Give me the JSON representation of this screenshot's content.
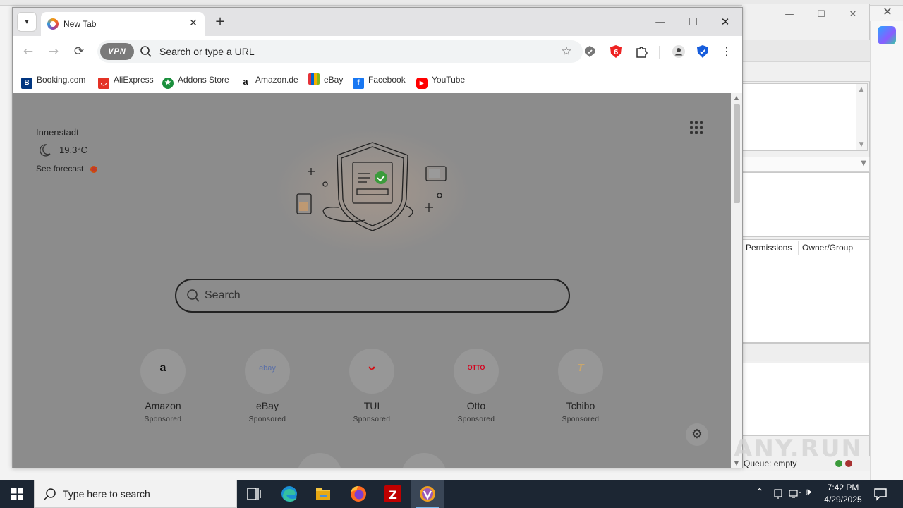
{
  "background_app": {
    "columns": [
      "Permissions",
      "Owner/Group"
    ],
    "queue_status": "Queue: empty"
  },
  "browser": {
    "tab_title": "New Tab",
    "omnibox_placeholder": "Search or type a URL",
    "vpn_label": "VPN",
    "bookmarks": [
      {
        "label": "Booking.com",
        "icon": "booking-icon",
        "color": "#003580"
      },
      {
        "label": "AliExpress",
        "icon": "aliexpress-icon",
        "color": "#e43225"
      },
      {
        "label": "Addons Store",
        "icon": "addons-store-icon",
        "color": "#1a8f3c"
      },
      {
        "label": "Amazon.de",
        "icon": "amazon-icon",
        "color": "#111111"
      },
      {
        "label": "eBay",
        "icon": "ebay-icon",
        "color": "#e53238"
      },
      {
        "label": "Facebook",
        "icon": "facebook-icon",
        "color": "#1877f2"
      },
      {
        "label": "YouTube",
        "icon": "youtube-icon",
        "color": "#ff0000"
      }
    ]
  },
  "newtab": {
    "weather": {
      "location": "Innenstadt",
      "temperature": "19.3°C",
      "forecast_link": "See forecast"
    },
    "search_placeholder": "Search",
    "tiles": [
      {
        "name": "Amazon",
        "logo": "a",
        "sponsored": "Sponsored",
        "logo_color": "#111111"
      },
      {
        "name": "eBay",
        "logo": "ebay",
        "sponsored": "Sponsored",
        "logo_color": "#5a6fa8"
      },
      {
        "name": "TUI",
        "logo": "ᴗ",
        "sponsored": "Sponsored",
        "logo_color": "#d40e14"
      },
      {
        "name": "Otto",
        "logo": "OTTO",
        "sponsored": "Sponsored",
        "logo_color": "#d4021d"
      },
      {
        "name": "Tchibo",
        "logo": "T",
        "sponsored": "Sponsored",
        "logo_color": "#c9a66b"
      }
    ]
  },
  "watermark": "ANY.RUN",
  "taskbar": {
    "search_placeholder": "Type here to search",
    "time": "7:42 PM",
    "date": "4/29/2025"
  },
  "colors": {
    "taskbar": "#1c2633",
    "page_dim": "#8c8c8c",
    "accent": "#0078d7"
  }
}
